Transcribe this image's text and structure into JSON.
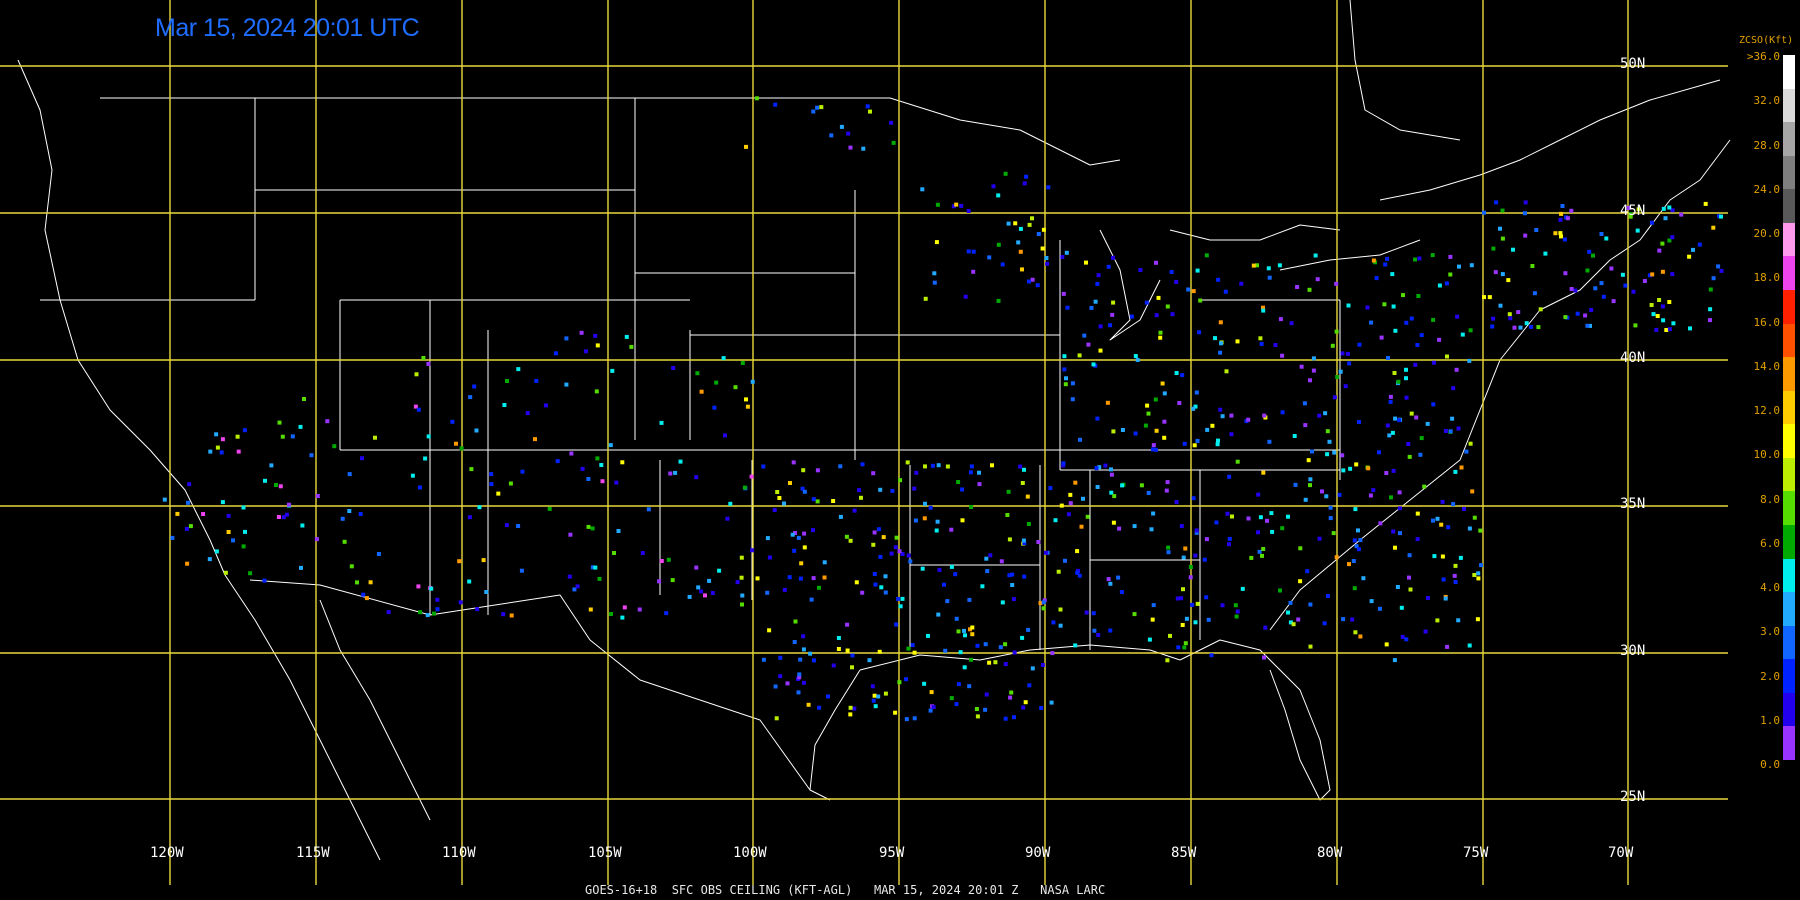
{
  "title": "Mar 15, 2024 20:01 UTC",
  "footer": "GOES-16+18  SFC OBS CEILING (KFT-AGL)   MAR 15, 2024 20:01 Z   NASA LARC",
  "latitude_labels": [
    "50N",
    "45N",
    "40N",
    "35N",
    "30N",
    "25N"
  ],
  "longitude_labels": [
    "120W",
    "115W",
    "110W",
    "105W",
    "100W",
    "95W",
    "90W",
    "85W",
    "80W",
    "75W",
    "70W"
  ],
  "legend": {
    "title": "ZCSO(Kft)",
    "labels": [
      ">36.0",
      "32.0",
      "28.0",
      "24.0",
      "20.0",
      "18.0",
      "16.0",
      "14.0",
      "12.0",
      "10.0",
      "8.0",
      "6.0",
      "4.0",
      "3.0",
      "2.0",
      "1.0",
      "0.0"
    ],
    "colors": [
      "#ffffff",
      "#d9d9d9",
      "#a6a6a6",
      "#7f7f7f",
      "#595959",
      "#ff99ee",
      "#ee44ee",
      "#ff2000",
      "#ff5000",
      "#ff9900",
      "#ffcc00",
      "#ffff00",
      "#bbee00",
      "#55dd00",
      "#00aa00",
      "#00eeee",
      "#22aaff",
      "#1166ff",
      "#0022ff",
      "#2200ee",
      "#9933ff"
    ]
  },
  "colors": {
    "grid": "#e8d83a",
    "coast": "#ffffff",
    "background": "#000000",
    "title": "#1e6dff",
    "legend_text": "#e0a000"
  }
}
